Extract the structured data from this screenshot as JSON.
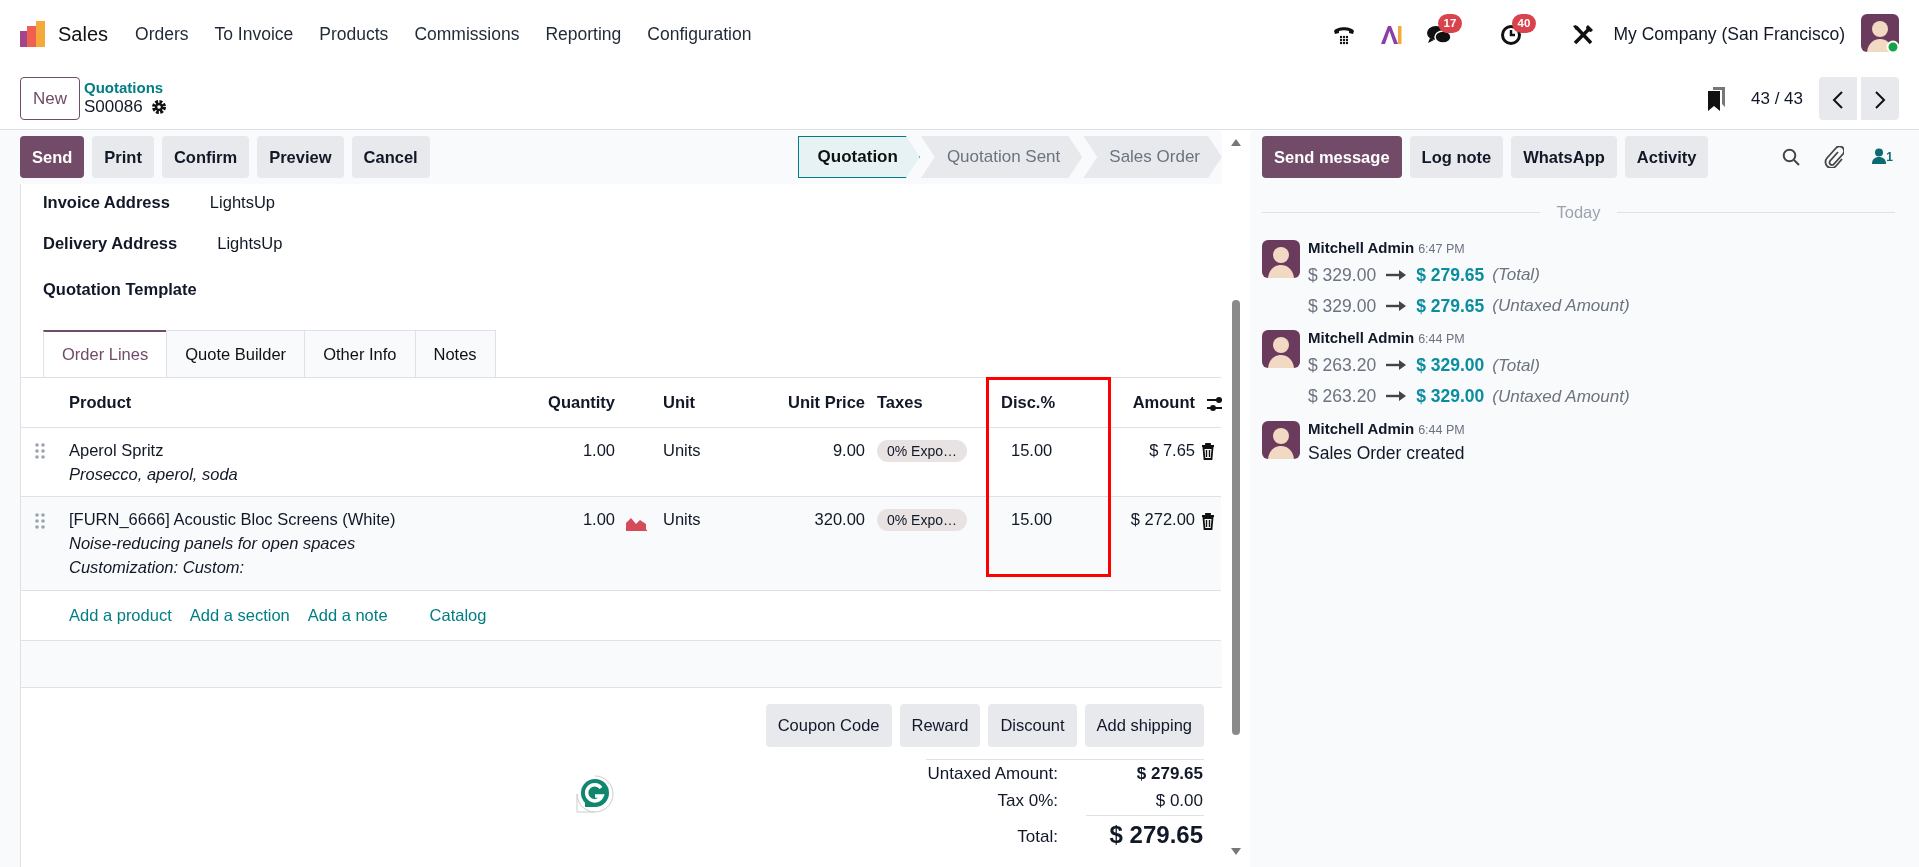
{
  "app": {
    "name": "Sales"
  },
  "menu": [
    "Orders",
    "To Invoice",
    "Products",
    "Commissions",
    "Reporting",
    "Configuration"
  ],
  "systray": {
    "messages_count": "17",
    "activities_count": "40",
    "company": "My Company (San Francisco)"
  },
  "control_panel": {
    "new_button": "New",
    "breadcrumb_parent": "Quotations",
    "record_name": "S00086",
    "pager": "43 / 43"
  },
  "actions": [
    {
      "label": "Send",
      "primary": true
    },
    {
      "label": "Print",
      "primary": false
    },
    {
      "label": "Confirm",
      "primary": false
    },
    {
      "label": "Preview",
      "primary": false
    },
    {
      "label": "Cancel",
      "primary": false
    }
  ],
  "statusbar": [
    {
      "label": "Quotation",
      "selected": true
    },
    {
      "label": "Quotation Sent",
      "selected": false
    },
    {
      "label": "Sales Order",
      "selected": false
    }
  ],
  "fields": [
    {
      "label": "Invoice Address",
      "value": "LightsUp"
    },
    {
      "label": "Delivery Address",
      "value": "LightsUp"
    },
    {
      "label": "Quotation Template"
    }
  ],
  "tabs": [
    {
      "label": "Order Lines",
      "selected": true
    },
    {
      "label": "Quote Builder",
      "selected": false
    },
    {
      "label": "Other Info",
      "selected": false
    },
    {
      "label": "Notes",
      "selected": false
    }
  ],
  "table": {
    "columns": [
      {
        "label": "Product",
        "highlighted": false
      },
      {
        "label": "Quantity",
        "highlighted": false
      },
      {
        "label": "Unit",
        "highlighted": false
      },
      {
        "label": "Unit Price",
        "highlighted": false
      },
      {
        "label": "Taxes",
        "highlighted": false
      },
      {
        "label": "Disc.%",
        "highlighted": true
      },
      {
        "label": "Amount",
        "highlighted": false
      }
    ],
    "rows": [
      {
        "product": "Aperol Spritz",
        "description": [
          "Prosecco, aperol, soda"
        ],
        "quantity": "1.00",
        "forecast_warning": false,
        "unit": "Units",
        "unit_price": "9.00",
        "taxes": "0% Expo…",
        "discount": "15.00",
        "amount": "$ 7.65"
      },
      {
        "product": "[FURN_6666] Acoustic Bloc Screens (White)",
        "description": [
          "Noise-reducing panels for open spaces",
          "Customization: Custom:"
        ],
        "quantity": "1.00",
        "forecast_warning": true,
        "unit": "Units",
        "unit_price": "320.00",
        "taxes": "0% Expo…",
        "discount": "15.00",
        "amount": "$ 272.00"
      }
    ]
  },
  "add_links": [
    "Add a product",
    "Add a section",
    "Add a note",
    "Catalog"
  ],
  "promo_buttons": [
    "Coupon Code",
    "Reward",
    "Discount",
    "Add shipping"
  ],
  "totals": [
    {
      "label": "Untaxed Amount:",
      "value": "$ 279.65",
      "kind": "subtotal"
    },
    {
      "label": "Tax 0%:",
      "value": "$ 0.00",
      "kind": "tax"
    },
    {
      "label": "Total:",
      "value": "$ 279.65",
      "kind": "total"
    }
  ],
  "chatter": {
    "buttons": [
      {
        "label": "Send message",
        "primary": true
      },
      {
        "label": "Log note",
        "primary": false
      },
      {
        "label": "WhatsApp",
        "primary": false
      },
      {
        "label": "Activity",
        "primary": false
      }
    ],
    "followers": "1",
    "date_divider": "Today",
    "messages": [
      {
        "author": "Mitchell Admin",
        "time": "6:47 PM",
        "changes": [
          {
            "old": "$ 329.00",
            "new": "$ 279.65",
            "field": "(Total)"
          },
          {
            "old": "$ 329.00",
            "new": "$ 279.65",
            "field": "(Untaxed Amount)"
          }
        ]
      },
      {
        "author": "Mitchell Admin",
        "time": "6:44 PM",
        "changes": [
          {
            "old": "$ 263.20",
            "new": "$ 329.00",
            "field": "(Total)"
          },
          {
            "old": "$ 263.20",
            "new": "$ 329.00",
            "field": "(Untaxed Amount)"
          }
        ]
      },
      {
        "author": "Mitchell Admin",
        "time": "6:44 PM",
        "body": "Sales Order created"
      }
    ]
  }
}
